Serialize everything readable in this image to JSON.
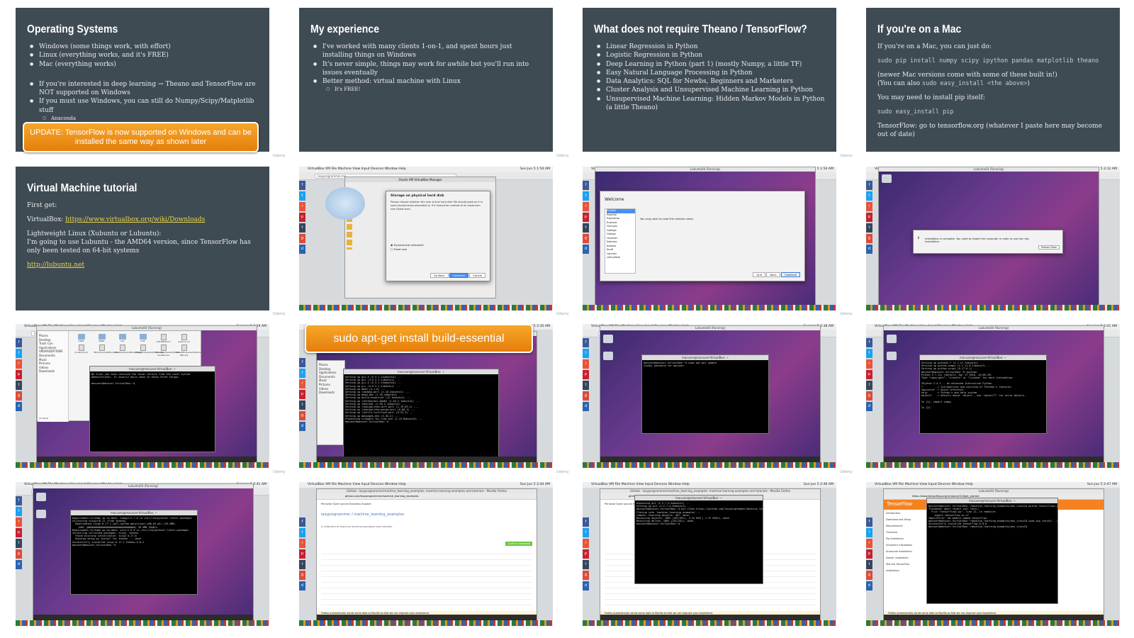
{
  "slides": {
    "operating_systems": {
      "title": "Operating Systems",
      "bullets": [
        "Windows (some things work, with effort)",
        "Linux (everything works, and it's FREE)",
        "Mac (everything works)"
      ],
      "bullets2": [
        "If you're interested in deep learning → Theano and TensorFlow are NOT supported on Windows",
        "If you must use Windows, you can still do Numpy/Scipy/Matplotlib stuff"
      ],
      "sub": "Anaconda",
      "banner": "UPDATE: TensorFlow is now supported on Windows and can be installed the same way as shown later"
    },
    "my_experience": {
      "title": "My experience",
      "bullets": [
        "I've worked with many clients 1-on-1, and spent hours just installing things on Windows",
        "It's never simple, things may work for awhile but you'll run into issues eventually",
        "Better method: virtual machine with Linux"
      ],
      "sub": "It's FREE!"
    },
    "no_theano": {
      "title": "What does not require Theano / TensorFlow?",
      "bullets": [
        "Linear Regression in Python",
        "Logistic Regression in Python",
        "Deep Learning in Python (part 1) (mostly Numpy, a little TF)",
        "Easy Natural Language Processing in Python",
        "Data Analytics: SQL for Newbs, Beginners and Marketers",
        "Cluster Analysis and Unsupervised Machine Learning in Python",
        "Unsupervised Machine Learning: Hidden Markov Models in Python (a little Theano)"
      ]
    },
    "mac": {
      "title": "If you're on a Mac",
      "p1": "If you're on a Mac, you can just do:",
      "cmd1": "sudo pip install numpy scipy ipython pandas matplotlib theano",
      "p2": "(newer Mac versions come with some of these built in!)",
      "p3a": "(You can also ",
      "p3code": "sudo easy_install <the above>",
      "p3b": ")",
      "p4": "You may need to install pip itself:",
      "cmd2": "sudo easy_install pip",
      "p5": "TensorFlow: go to tensorflow.org (whatever I paste here may become out of date)"
    },
    "vm_tutorial": {
      "title": "Virtual Machine tutorial",
      "p1": "First get:",
      "p2_label": "VirtualBox: ",
      "p2_link": "https://www.virtualbox.org/wiki/Downloads",
      "p3": "Lightweight Linux (Xubuntu or Lubuntu):",
      "p4": "I'm going to use Lubuntu - the AMD64 version, since TensorFlow has only been tested on 64-bit systems",
      "p5_link": "http://lubuntu.net"
    }
  },
  "watermark": "Udemy",
  "mac_menu": {
    "items": "VirtualBox VM   File   Machine   View   Input   Devices   Window   Help",
    "clock_a": "Sun Jun 5  1:54 AM",
    "clock_b": "Sun Jun 5  2:12 AM",
    "clock_c": "Sun Jun 5  2:19 AM",
    "clock_d": "Sun Jun 5  2:35 AM",
    "clock_e": "Sun Jun 5  2:38 AM",
    "clock_f": "Sun Jun 5  2:41 AM",
    "clock_g": "Sun Jun 5  2:44 AM",
    "clock_h": "Sun Jun 5  2:46 AM",
    "clock_i": "Sun Jun 5  2:47 AM"
  },
  "vm_window_title": "Lubuntu64 (Running)",
  "vbox_manager_title": "Oracle VM VirtualBox Manager",
  "storage_dialog": {
    "title": "Storage on physical hard disk",
    "text": "Please choose whether the new virtual hard disk file should grow as it is used (dynamically allocated) or if it should be created at its maximum size (fixed size).",
    "option1": "Dynamically allocated",
    "option2": "Fixed size",
    "back": "Go Back",
    "continue": "Continue",
    "cancel": "Cancel"
  },
  "browser": {
    "url1": "lazyprogrammer.me",
    "url2": "github.com/lazyprogrammer/machine_learning_examples",
    "url3": "https://www.tensorflow.org/versions/r0.8/get_started"
  },
  "welcome_dialog": {
    "title": "Welcome",
    "languages": [
      "English",
      "Español",
      "Esperanto",
      "Euskara",
      "Français",
      "Gaeilge",
      "Galego",
      "Hrvatski",
      "Íslenska",
      "Italiano",
      "Kurdî",
      "Latviski",
      "Lietuviškai"
    ],
    "note": "You may wish to read the release notes.",
    "quit": "Quit",
    "back": "Back",
    "continue": "Continue"
  },
  "install_complete": "Installation is complete. You need to restart the computer in order to use the new installation.",
  "restart_now": "Restart Now",
  "terminal_title": "macuser@macuser-VirtualBox: ~",
  "build_banner": "sudo apt-get install build-essential",
  "github": {
    "title": "GitHub - lazyprogrammer/machine_learning_examples: machine learning examples and tutorials - Mozilla Firefox",
    "repo": "lazyprogrammer / machine_learning_examples",
    "desc": "A collection of machine learning examples and tutorials.",
    "nav": "Personal   Open source   Business   Explore",
    "clone": "Clone or download",
    "notice": "Firefox automatically sends some data to Mozilla so that we can improve your experience."
  },
  "terminals": {
    "t1": "We trust you have received the usual lecture from the local System\nAdministrator. It usually boils down to these three things:\n\nmacuser@macuser-VirtualBox:~$ ",
    "t2": "Setting up gcc-5 (5.3.1-14ubuntu2) ...\nSetting up gcc (4:5.3.1-1ubuntu1) ...\nSetting up g++-5 (5.3.1-14ubuntu2) ...\nSetting up g++ (4:5.3.1-1ubuntu1) ...\nSetting up make (4.1-6) ...\nSetting up libdpkg-perl (1.18.4ubuntu1) ...\nSetting up dpkg-dev (1.18.4ubuntu1) ...\nSetting up build-essential (12.1ubuntu2) ...\nSetting up libfakeroot:amd64 (1.20.2-1ubuntu1) ...\nSetting up fakeroot (1.20.2-1ubuntu1) ...\nSetting up libalgorithm-diff-perl (1.19.03-1) ...\nSetting up libalgorithm-merge-perl (0.08-3) ...\nSetting up libfile-fcntllock-perl (0.22-3) ...\nSetting up manpages-dev (4.04-2) ...\nProcessing triggers for libc-bin (2.23-0ubuntu3) ...\nmacuser@macuser-VirtualBox:~$ ",
    "t3": "macuser@macuser-VirtualBox:~$ sudo apt-get update\n[sudo] password for macuser: ",
    "t4": "Setting up python2.7 (2.7.11-7ubuntu1) ...\nSetting up python-numpy (1:1.11.0-1ubuntu1) ...\nSetting up python-scipy (0.17.0-1) ...\nmacuser@macuser-VirtualBox:~$ ipython\nPython 2.7.11+ (default, Apr 17 2016, 14:00:29)\nType \"copyright\", \"credits\" or \"license\" for more information.\n\nIPython 2.4.1 -- An enhanced Interactive Python.\n?         -> Introduction and overview of IPython's features.\n%quickref -> Quick reference.\nhelp      -> Python's own help system.\nobject?   -> Details about 'object', use 'object??' for extra details.\n\nIn [1]: import numpy\n\nIn [2]: ",
    "t5": "Requirement already up-to-date: numpy>=1.7.0 in /usr/lib/python2.7/dist-packages\nCollecting scipy>=0.11 (from theano)\n  Downloading scipy-0.17.1-cp27-cp27mu-manylinux1_x86_64.whl (39.5MB)\n    100% |################################| 39.5MB 35kB/s\nRequirement already up-to-date: six>=1.9.0 in /usr/lib/python2.7/dist-packages\nInstalling collected packages: scipy, theano\n  Found existing installation: scipy 0.17.0\n  Running setup.py install for theano ... done\nSuccessfully installed scipy-0.17.1 theano-0.8.2\nmacuser@macuser-VirtualBox:~$ ",
    "t6": "Unpacking git (1:2.7.4-0ubuntu1) ...\nSetting up git (1:2.7.4-0ubuntu1) ...\nmacuser@macuser-VirtualBox:~$ git clone https://github.com/lazyprogrammer/machine_learning_examples.git\nCloning into 'machine_learning_examples'...\nremote: Counting objects: 467, done.\nReceiving objects: 100% (467/467), 3.42 MiB | 1.47 MiB/s, done.\nResolving deltas: 100% (251/251), done.\nmacuser@macuser-VirtualBox:~$ ",
    "t7": "macuser@macuser-VirtualBox:~/machine_learning_examples/ann_class2$ python tensorflow1.py\nTraceback (most recent call last):\n  File \"tensorflow1.py\", line 11, in <module>\n    import tensorflow as tf\nImportError: No module named tensorflow\nmacuser@macuser-VirtualBox:~/machine_learning_examples/ann_class2$ sudo pip install --upgrade $TF_BINARY_URL\nSuccessfully installed tensorflow-0.8.0\nmacuser@macuser-VirtualBox:~/machine_learning_examples/ann_class2$ "
  },
  "file_manager": {
    "sidebar": [
      "Places",
      "Desktop",
      "Trash Can",
      "Applications",
      "VBOXADDITIONS",
      "Documents",
      "Music",
      "Pictures",
      "Videos",
      "Downloads"
    ],
    "files": [
      "32Bit",
      "64Bit",
      "cert",
      "OS2",
      "AUTORUN.inf",
      "autorun.sh",
      "runasroot.sh",
      "VBoxLinuxAdditions.run",
      "VBoxSolarisAdditions.pkg",
      "VBoxWindowsAdditions.exe",
      "VBoxWindowsAdditions-amd64.exe",
      "VBoxWindowsAdditions-x86.exe"
    ],
    "status": "12 items"
  },
  "tensorflow_page": {
    "brand": "TensorFlow",
    "side": [
      "Introduction",
      "Download and Setup",
      "Requirements",
      "Overview",
      "Pip Installation",
      "Virtualenv installation",
      "Anaconda installation",
      "Docker installation",
      "Test the TensorFlow installation"
    ]
  },
  "colors": {
    "slide_bg": "#3f4b53",
    "banner_orange": "#f29621",
    "link_yellow": "#e7d44e"
  }
}
